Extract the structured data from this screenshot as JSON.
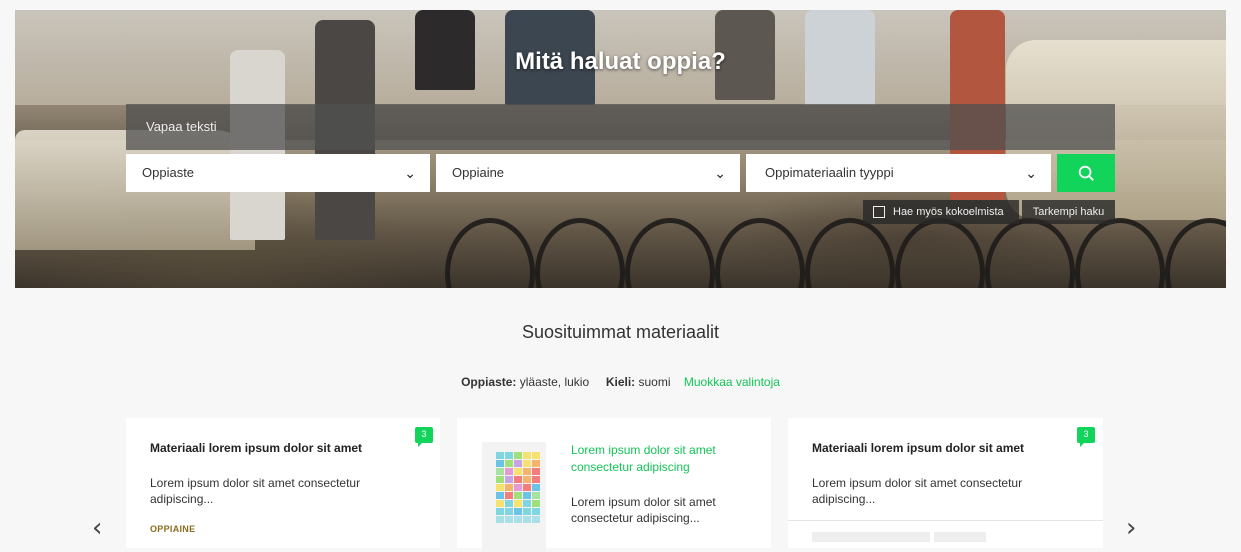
{
  "hero": {
    "title": "Mitä haluat oppia?",
    "free_text_placeholder": "Vapaa teksti",
    "selects": [
      {
        "label": "Oppiaste"
      },
      {
        "label": "Oppiaine"
      },
      {
        "label": "Oppimateriaalin tyyppi"
      }
    ],
    "checkbox_label": "Hae myös kokoelmista",
    "advanced_label": "Tarkempi haku"
  },
  "popular": {
    "title": "Suosituimmat materiaalit",
    "filters": [
      {
        "key": "Oppiaste:",
        "value": "yläaste, lukio"
      },
      {
        "key": "Kieli:",
        "value": "suomi"
      }
    ],
    "edit_label": "Muokkaa valintoja"
  },
  "cards": [
    {
      "title": "Materiaali lorem ipsum dolor sit amet",
      "description": "Lorem ipsum dolor sit amet consectetur adipiscing...",
      "badge": "3",
      "subject_label": "OPPIAINE"
    },
    {
      "title": "Lorem ipsum dolor sit amet consectetur adipiscing",
      "description": "Lorem ipsum dolor sit amet consectetur adipiscing..."
    },
    {
      "title": "Materiaali lorem ipsum dolor sit amet",
      "description": "Lorem ipsum dolor sit amet consectetur adipiscing...",
      "badge": "3"
    }
  ],
  "icons": {
    "search": "search-icon",
    "chevron": "chevron-down-icon",
    "prev": "chevron-left-icon",
    "next": "chevron-right-icon"
  },
  "colors": {
    "accent": "#13d45b",
    "subject": "#8a6d1f"
  }
}
